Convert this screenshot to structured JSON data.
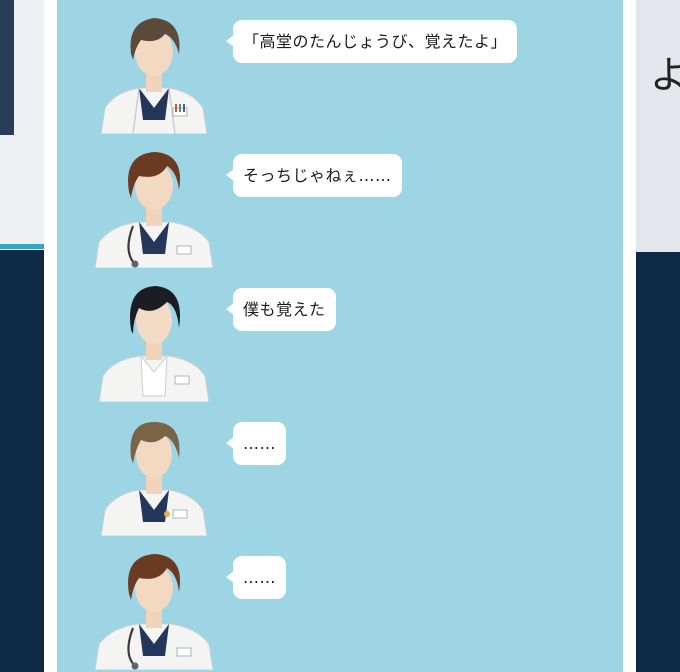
{
  "colors": {
    "chat_bg": "#9dd5e5",
    "bubble_bg": "#ffffff",
    "page_bg": "#0f2a45"
  },
  "background": {
    "right_glyph": "よ"
  },
  "messages": [
    {
      "text": "「高堂のたんじょうび、覚えたよ」",
      "hair": "#5c4a3a",
      "icon": "doctor-avatar-icon"
    },
    {
      "text": "そっちじゃねぇ……",
      "hair": "#6b3a22",
      "icon": "doctor-avatar-icon"
    },
    {
      "text": "僕も覚えた",
      "hair": "#1c1d24",
      "icon": "doctor-avatar-icon"
    },
    {
      "text": "……",
      "hair": "#7a6448",
      "icon": "doctor-avatar-icon"
    },
    {
      "text": "……",
      "hair": "#6b3a22",
      "icon": "doctor-avatar-icon"
    }
  ]
}
